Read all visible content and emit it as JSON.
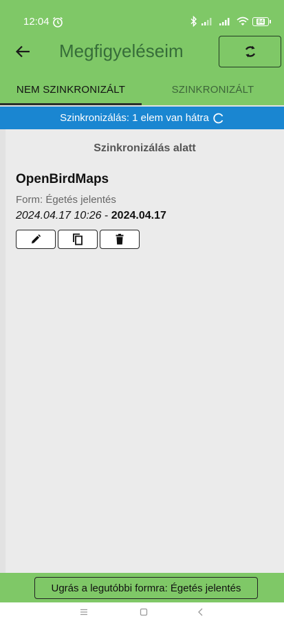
{
  "status": {
    "time": "12:04",
    "battery": "84"
  },
  "appbar": {
    "title": "Megfigyeléseim"
  },
  "tabs": [
    {
      "label": "NEM SZINKRONIZÁLT"
    },
    {
      "label": "SZINKRONIZÁLT"
    }
  ],
  "banner": {
    "text": "Szinkronizálás: 1 elem van hátra"
  },
  "content": {
    "syncing_label": "Szinkronizálás alatt",
    "item": {
      "title": "OpenBirdMaps",
      "form": "Form: Égetés jelentés",
      "date_start": "2024.04.17 10:26",
      "separator": " - ",
      "date_end": "2024.04.17"
    }
  },
  "bottom": {
    "jump_label": "Ugrás a legutóbbi formra: Égetés jelentés"
  },
  "colors": {
    "green": "#7fc867",
    "blue": "#1a86d1",
    "background": "#ebebeb"
  }
}
